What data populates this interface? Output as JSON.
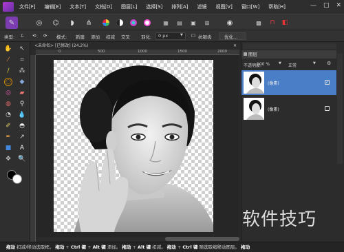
{
  "menu": {
    "items": [
      "文件[F]",
      "编辑[E]",
      "文本[T]",
      "文档[D]",
      "图层[L]",
      "选择[S]",
      "排列[A]",
      "滤镜",
      "视图[V]",
      "窗口[W]",
      "帮助[H]"
    ],
    "window_controls": [
      "—",
      "□",
      "✕"
    ]
  },
  "context_bar": {
    "type_label": "类型:",
    "mode_label": "模式:",
    "mode_new": "新建",
    "mode_add": "添加",
    "mode_subtract": "扣减",
    "mode_intersect": "交叉",
    "feather_label": "羽化:",
    "feather_value": "0 px",
    "antialias_label": "抗锯齿",
    "refine_button": "优化..."
  },
  "document": {
    "tab_title": "<未命名> [已修改] (24.2%)",
    "ruler_ticks": [
      "0",
      "500",
      "1000",
      "1500",
      "2000"
    ]
  },
  "layers_panel": {
    "title": "图层",
    "opacity_label": "不透明度:",
    "opacity_value": "100 %",
    "blend_mode": "正常",
    "layers": [
      {
        "name": "(像素)",
        "selected": true,
        "checked": true
      },
      {
        "name": "(像素)",
        "selected": false,
        "checked": false
      }
    ]
  },
  "status": {
    "parts": [
      "拖动",
      " 扣减/移动选取框。",
      "拖动",
      " + ",
      "Ctrl 键",
      " + ",
      "Alt 键",
      " 添加。",
      "拖动",
      " + ",
      "Alt 键",
      " 扣减。",
      "拖动",
      " + ",
      "Ctrl 键",
      " 随选取缩移动图层。",
      "拖动"
    ]
  },
  "watermark": "软件技巧",
  "colors": {
    "accent": "#4a7fc8",
    "panel_bg": "#2c2c2c",
    "logo": "#9a35c8"
  }
}
